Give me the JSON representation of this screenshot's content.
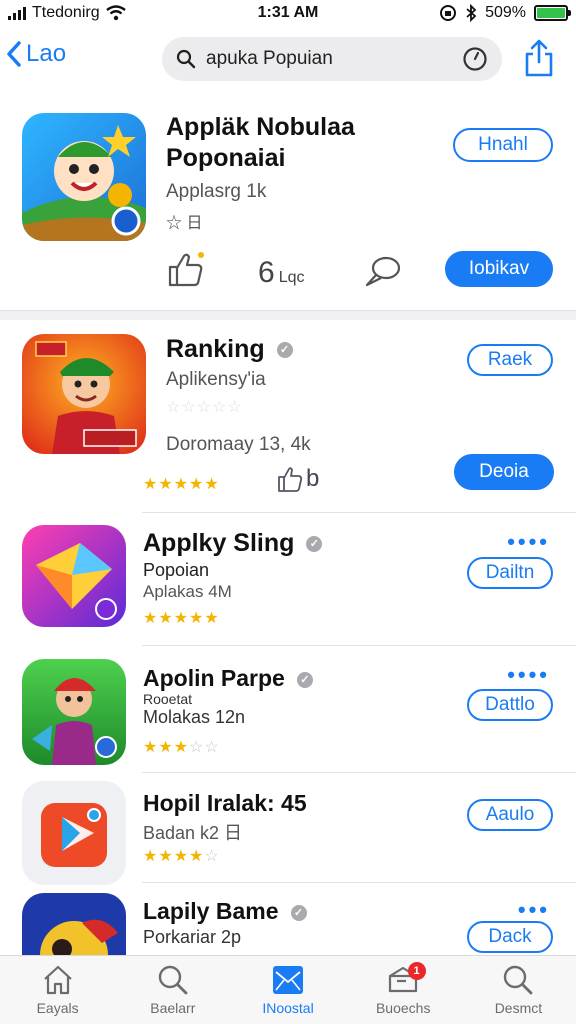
{
  "status": {
    "carrier": "Ttedonirg",
    "time": "1:31 AM",
    "battery": "509%",
    "battery_level": 1.0
  },
  "nav": {
    "back_label": "Lao",
    "search_value": "apuka Popuian"
  },
  "featured": {
    "name_line1": "Appläk Nobulaa",
    "name_line2": "Poponaiai",
    "subtitle": "Applasrg 1k",
    "meta": "☆ 日",
    "top_button": "Hnahl",
    "count_text": "6",
    "count_unit": "Lqc",
    "action_button": "Iobikav"
  },
  "apps": [
    {
      "name": "Ranking",
      "sub1": "Aplikensy'ia",
      "sub2": "Doromaay 13, 4k",
      "button": "Raek",
      "action_button": "Deoia",
      "faint_rating": 5,
      "rating": 4.5,
      "extra": "b"
    },
    {
      "name": "Applky Sling",
      "sub1": "Popoian",
      "sub2": "Aplakas 4M",
      "button": "Dailtn",
      "rating": 5
    },
    {
      "name": "Apolin Parpe",
      "sub1": "Rooetat",
      "sub2": "Molakas 12n",
      "button": "Dattlo",
      "rating": 3
    },
    {
      "name": "Hopil Iralak: 45",
      "sub1": "Badan k2 日",
      "button": "Aaulo",
      "rating": 4
    },
    {
      "name": "Lapily Bame",
      "sub1": "Porkariar 2p",
      "button": "Dack"
    }
  ],
  "tabs": [
    {
      "label": "Eayals",
      "icon": "house-icon"
    },
    {
      "label": "Baelarr",
      "icon": "search-icon"
    },
    {
      "label": "INoostal",
      "icon": "mail-icon",
      "active": true
    },
    {
      "label": "Buoechs",
      "icon": "box-icon",
      "badge": "1"
    },
    {
      "label": "Desmct",
      "icon": "search-icon"
    }
  ],
  "colors": {
    "accent": "#1a7cf5",
    "star": "#f5b400",
    "badge": "#e8282b"
  }
}
